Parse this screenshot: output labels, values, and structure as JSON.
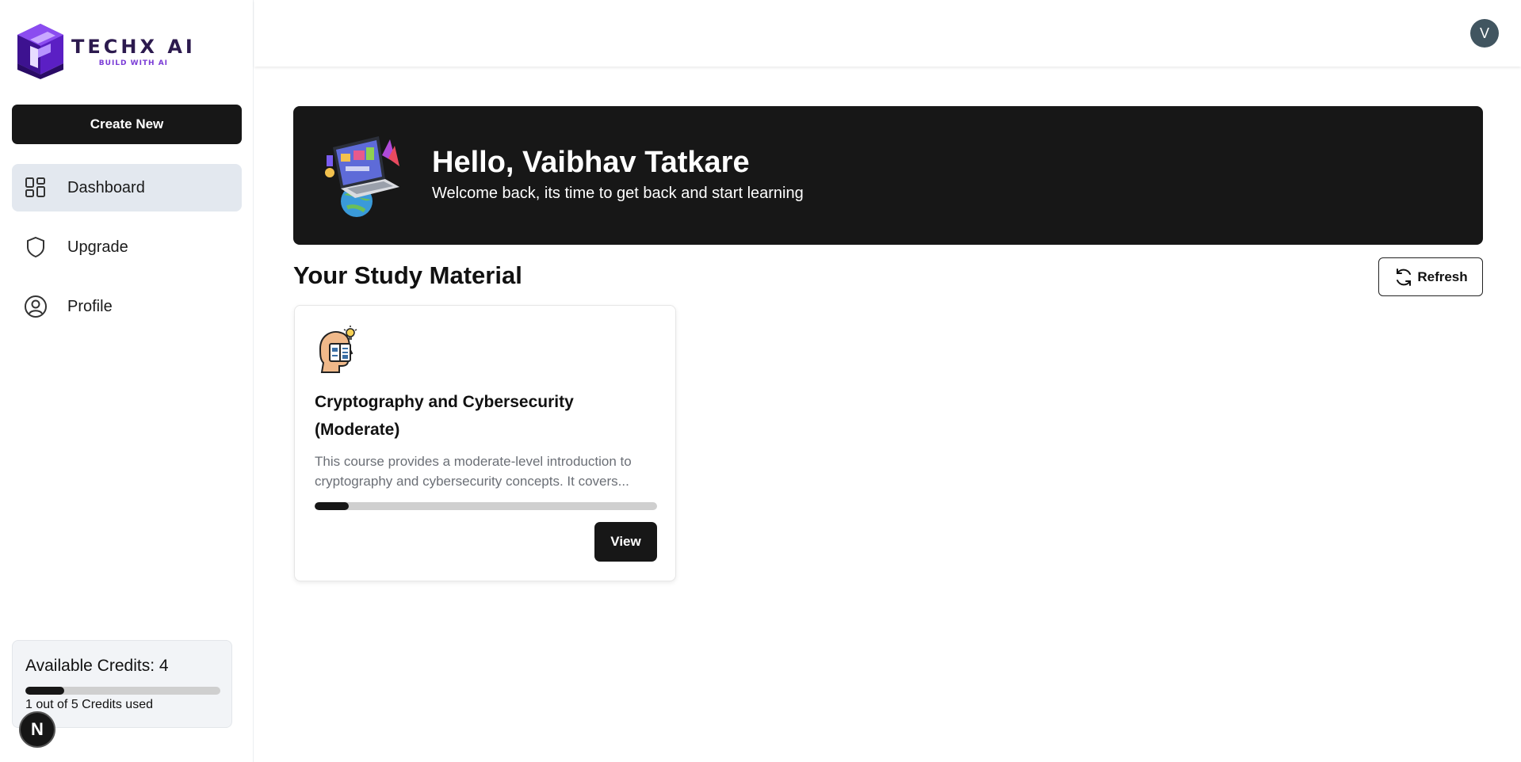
{
  "brand": {
    "name": "TECHX AI",
    "tagline": "BUILD WITH AI",
    "logo_icon": "cube-logo-icon",
    "accent": "#6c2bd9"
  },
  "sidebar": {
    "create_label": "Create New",
    "items": [
      {
        "label": "Dashboard",
        "icon": "dashboard-grid-icon",
        "active": true
      },
      {
        "label": "Upgrade",
        "icon": "shield-icon",
        "active": false
      },
      {
        "label": "Profile",
        "icon": "user-circle-icon",
        "active": false
      }
    ],
    "credits": {
      "title": "Available Credits: 4",
      "subtitle": "1 out of 5 Credits used",
      "used_fraction": 0.2
    }
  },
  "header": {
    "avatar_initial": "V"
  },
  "banner": {
    "title": "Hello, Vaibhav Tatkare",
    "subtitle": "Welcome back, its time to get back and start learning",
    "illustration": "laptop-globe-illustration"
  },
  "study": {
    "section_title": "Your Study Material",
    "refresh_label": "Refresh",
    "courses": [
      {
        "title": "Cryptography and Cybersecurity (Moderate)",
        "description": "This course provides a moderate-level introduction to cryptography and cybersecurity concepts. It covers...",
        "progress_fraction": 0.1,
        "view_label": "View",
        "icon": "head-book-idea-icon"
      }
    ]
  },
  "devtools_badge": "N",
  "colors": {
    "dark": "#171717",
    "active_nav": "#e3e8ef",
    "track": "#cfcfcf",
    "avatar": "#415560"
  }
}
